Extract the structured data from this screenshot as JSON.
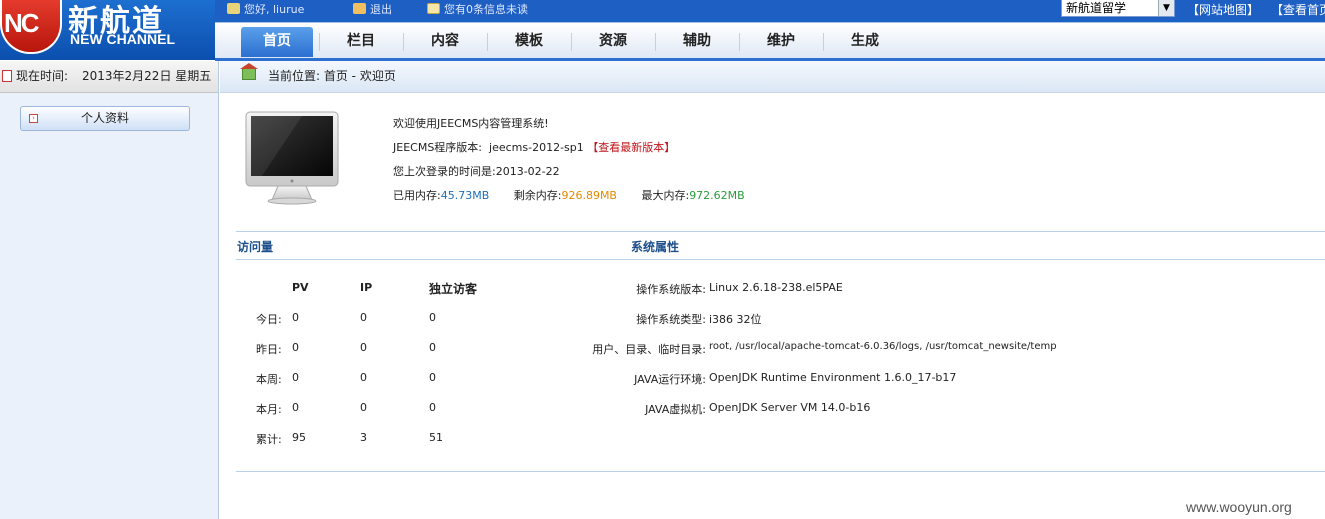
{
  "header": {
    "logo_cn": "新航道",
    "logo_en": "NEW CHANNEL",
    "logo_mark": "NC",
    "greeting": "您好, liurue",
    "logout": "退出",
    "messages": "您有0条信息未读",
    "site_select": "新航道留学",
    "link_sitemap": "【网站地图】",
    "link_home": "【查看首页】"
  },
  "nav": {
    "tabs": [
      "首页",
      "栏目",
      "内容",
      "模板",
      "资源",
      "辅助",
      "维护",
      "生成"
    ],
    "active": 0
  },
  "sidebar": {
    "date_label": "现在时间:",
    "date_value": "2013年2月22日 星期五",
    "menu_item": "个人资料"
  },
  "breadcrumb": {
    "text": "当前位置: 首页 - 欢迎页"
  },
  "welcome": {
    "line1": "欢迎使用JEECMS内容管理系统!",
    "version_label": "JEECMS程序版本:",
    "version_value": "jeecms-2012-sp1",
    "latest_link": "【查看最新版本】",
    "last_login_label": "您上次登录的时间是:",
    "last_login_value": "2013-02-22",
    "mem_used_label": "已用内存:",
    "mem_used": "45.73MB",
    "mem_free_label": "剩余内存:",
    "mem_free": "926.89MB",
    "mem_max_label": "最大内存:",
    "mem_max": "972.62MB"
  },
  "visits": {
    "title": "访问量",
    "columns": [
      "PV",
      "IP",
      "独立访客"
    ],
    "rows": [
      {
        "label": "今日:",
        "pv": "0",
        "ip": "0",
        "uv": "0"
      },
      {
        "label": "昨日:",
        "pv": "0",
        "ip": "0",
        "uv": "0"
      },
      {
        "label": "本周:",
        "pv": "0",
        "ip": "0",
        "uv": "0"
      },
      {
        "label": "本月:",
        "pv": "0",
        "ip": "0",
        "uv": "0"
      },
      {
        "label": "累计:",
        "pv": "95",
        "ip": "3",
        "uv": "51"
      }
    ]
  },
  "system": {
    "title": "系统属性",
    "rows": [
      {
        "label": "操作系统版本:",
        "value": "Linux 2.6.18-238.el5PAE"
      },
      {
        "label": "操作系统类型:",
        "value": "i386 32位"
      },
      {
        "label": "用户、目录、临时目录:",
        "value": "root, /usr/local/apache-tomcat-6.0.36/logs, /usr/tomcat_newsite/temp"
      },
      {
        "label": "JAVA运行环境:",
        "value": "OpenJDK Runtime Environment 1.6.0_17-b17"
      },
      {
        "label": "JAVA虚拟机:",
        "value": "OpenJDK Server VM 14.0-b16"
      }
    ]
  },
  "watermark": "www.wooyun.org"
}
